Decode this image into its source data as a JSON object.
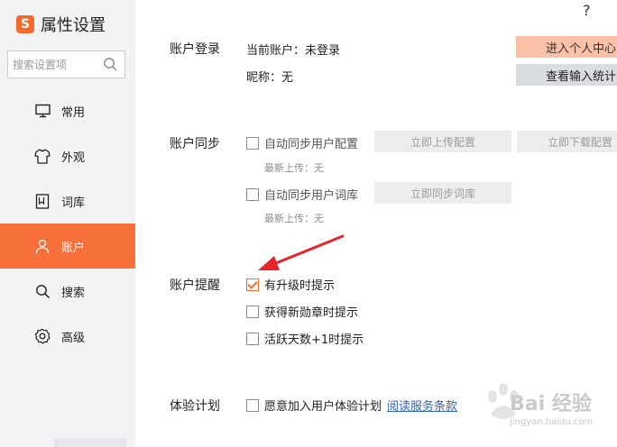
{
  "app": {
    "logo_letter": "S",
    "title": "属性设置",
    "help_icon": "?"
  },
  "search": {
    "placeholder": "搜索设置项"
  },
  "sidebar": {
    "items": [
      {
        "label": "常用",
        "icon": "monitor-icon"
      },
      {
        "label": "外观",
        "icon": "shirt-icon"
      },
      {
        "label": "词库",
        "icon": "dictionary-icon"
      },
      {
        "label": "账户",
        "icon": "user-icon",
        "active": true
      },
      {
        "label": "搜索",
        "icon": "search-icon"
      },
      {
        "label": "高级",
        "icon": "gear-icon"
      }
    ]
  },
  "account_login": {
    "title": "账户登录",
    "current_account": "当前账户：未登录",
    "nickname": "昵称：无",
    "personal_center_button": "进入个人中心",
    "input_stats_button": "查看输入统计"
  },
  "account_sync": {
    "title": "账户同步",
    "sync_config_label": "自动同步用户配置",
    "upload_config_button": "立即上传配置",
    "download_config_button": "立即下载配置",
    "last_upload_config": "最新上传：无",
    "sync_dict_label": "自动同步用户词库",
    "sync_dict_button": "立即同步词库",
    "last_upload_dict": "最新上传：无"
  },
  "account_reminder": {
    "title": "账户提醒",
    "options": [
      {
        "label": "有升级时提示",
        "checked": true
      },
      {
        "label": "获得新勋章时提示",
        "checked": false
      },
      {
        "label": "活跃天数+1时提示",
        "checked": false
      }
    ]
  },
  "experience_plan": {
    "title": "体验计划",
    "join_label": "愿意加入用户体验计划",
    "terms_link": "阅读服务条款"
  },
  "watermark": {
    "text": "Bai 经验",
    "sub": "jingyan.baidu.com"
  },
  "colors": {
    "accent": "#f7703a",
    "sidebar_bg": "#f2f3f5",
    "annotation_arrow": "#e8232b"
  }
}
